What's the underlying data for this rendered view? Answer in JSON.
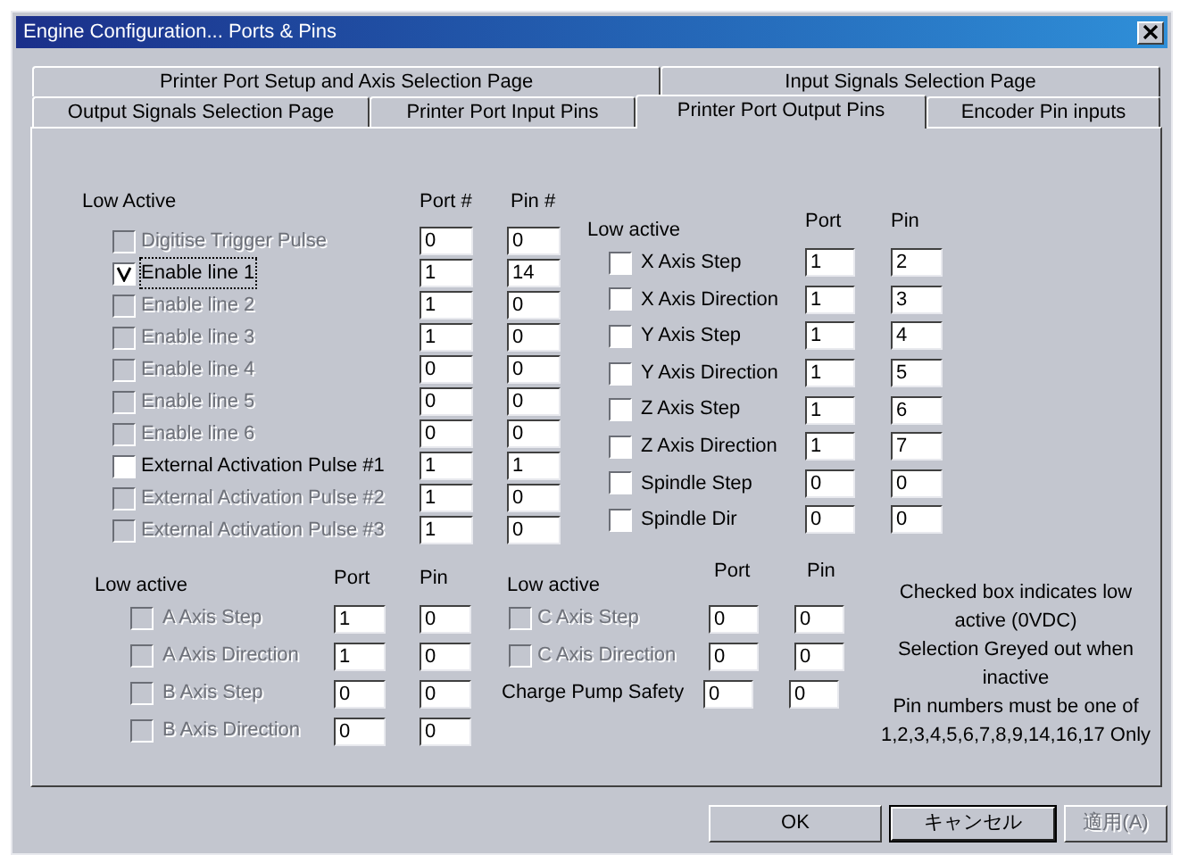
{
  "window": {
    "title": "Engine Configuration... Ports & Pins"
  },
  "tab_rows": [
    [
      {
        "label": "Printer Port Setup and Axis Selection Page",
        "selected": false
      },
      {
        "label": "Input Signals Selection Page",
        "selected": false
      }
    ],
    [
      {
        "label": "Output Signals Selection Page",
        "selected": false
      },
      {
        "label": "Printer Port Input Pins",
        "selected": false
      },
      {
        "label": "Printer Port Output Pins",
        "selected": true
      },
      {
        "label": "Encoder Pin inputs",
        "selected": false
      }
    ]
  ],
  "signals": {
    "heading": "Low Active",
    "port_heading": "Port #",
    "pin_heading": "Pin #",
    "rows": [
      {
        "label": "Digitise Trigger Pulse",
        "checked": false,
        "disabled": true,
        "focused": false,
        "port": "0",
        "pin": "0"
      },
      {
        "label": "Enable line 1",
        "checked": true,
        "disabled": false,
        "focused": true,
        "port": "1",
        "pin": "14"
      },
      {
        "label": "Enable line 2",
        "checked": false,
        "disabled": true,
        "focused": false,
        "port": "1",
        "pin": "0"
      },
      {
        "label": "Enable line 3",
        "checked": false,
        "disabled": true,
        "focused": false,
        "port": "1",
        "pin": "0"
      },
      {
        "label": "Enable line 4",
        "checked": false,
        "disabled": true,
        "focused": false,
        "port": "0",
        "pin": "0"
      },
      {
        "label": "Enable line 5",
        "checked": false,
        "disabled": true,
        "focused": false,
        "port": "0",
        "pin": "0"
      },
      {
        "label": "Enable line 6",
        "checked": false,
        "disabled": true,
        "focused": false,
        "port": "0",
        "pin": "0"
      },
      {
        "label": "External Activation Pulse #1",
        "checked": false,
        "disabled": false,
        "focused": false,
        "port": "1",
        "pin": "1"
      },
      {
        "label": "External Activation Pulse #2",
        "checked": false,
        "disabled": true,
        "focused": false,
        "port": "1",
        "pin": "0"
      },
      {
        "label": "External Activation Pulse #3",
        "checked": false,
        "disabled": true,
        "focused": false,
        "port": "1",
        "pin": "0"
      }
    ]
  },
  "axes": {
    "heading": "Low active",
    "port_heading": "Port",
    "pin_heading": "Pin",
    "rows": [
      {
        "label": "X Axis Step",
        "checked": false,
        "disabled": false,
        "port": "1",
        "pin": "2"
      },
      {
        "label": "X Axis Direction",
        "checked": false,
        "disabled": false,
        "port": "1",
        "pin": "3"
      },
      {
        "label": "Y Axis Step",
        "checked": false,
        "disabled": false,
        "port": "1",
        "pin": "4"
      },
      {
        "label": "Y Axis Direction",
        "checked": false,
        "disabled": false,
        "port": "1",
        "pin": "5"
      },
      {
        "label": "Z Axis Step",
        "checked": false,
        "disabled": false,
        "port": "1",
        "pin": "6"
      },
      {
        "label": "Z Axis Direction",
        "checked": false,
        "disabled": false,
        "port": "1",
        "pin": "7"
      },
      {
        "label": "Spindle Step",
        "checked": false,
        "disabled": false,
        "port": "0",
        "pin": "0"
      },
      {
        "label": "Spindle Dir",
        "checked": false,
        "disabled": false,
        "port": "0",
        "pin": "0"
      }
    ]
  },
  "ab_axes": {
    "heading": "Low active",
    "port_heading": "Port",
    "pin_heading": "Pin",
    "rows": [
      {
        "label": "A Axis Step",
        "checked": false,
        "disabled": true,
        "port": "1",
        "pin": "0"
      },
      {
        "label": "A Axis Direction",
        "checked": false,
        "disabled": true,
        "port": "1",
        "pin": "0"
      },
      {
        "label": "B Axis Step",
        "checked": false,
        "disabled": true,
        "port": "0",
        "pin": "0"
      },
      {
        "label": "B Axis Direction",
        "checked": false,
        "disabled": true,
        "port": "0",
        "pin": "0"
      }
    ]
  },
  "c_axis": {
    "heading": "Low active",
    "port_heading": "Port",
    "pin_heading": "Pin",
    "rows": [
      {
        "kind": "checkbox",
        "label": "C Axis Step",
        "checked": false,
        "disabled": true,
        "port": "0",
        "pin": "0"
      },
      {
        "kind": "checkbox",
        "label": "C Axis Direction",
        "checked": false,
        "disabled": true,
        "port": "0",
        "pin": "0"
      },
      {
        "kind": "plain",
        "label": "Charge Pump Safety",
        "disabled": false,
        "port": "0",
        "pin": "0"
      }
    ]
  },
  "notes": [
    "Checked box indicates low active (0VDC)",
    "Selection Greyed out when inactive",
    "Pin numbers must be one of 1,2,3,4,5,6,7,8,9,14,16,17 Only"
  ],
  "buttons": [
    {
      "label": "OK",
      "disabled": false,
      "default": false
    },
    {
      "label": "キャンセル",
      "disabled": false,
      "default": true
    },
    {
      "label": "適用(A)",
      "disabled": true,
      "default": false
    }
  ]
}
